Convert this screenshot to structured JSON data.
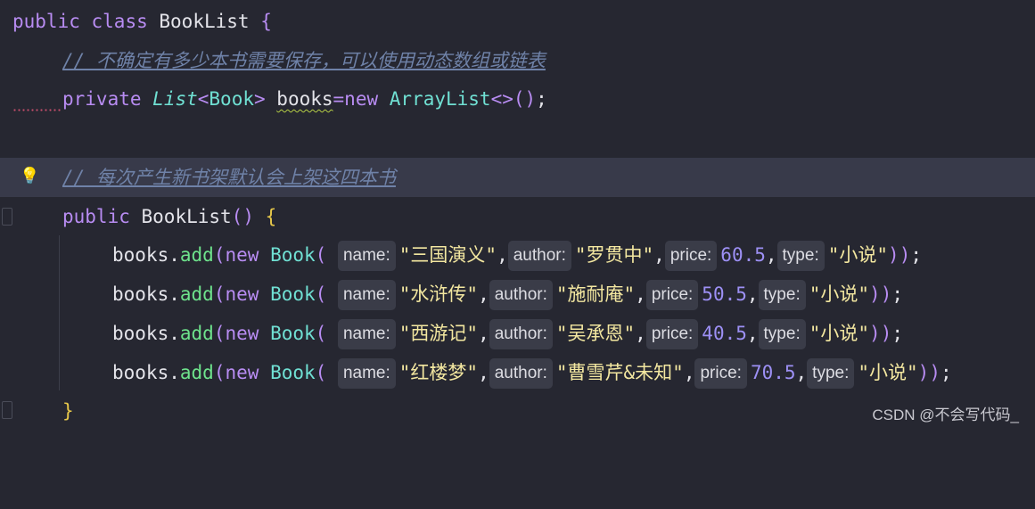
{
  "code": {
    "l1": {
      "kw_public": "public",
      "kw_class": "class",
      "class_name": "BookList",
      "open": "{"
    },
    "l2": {
      "comment": "// 不确定有多少本书需要保存，可以使用动态数组或链表"
    },
    "l3": {
      "kw_private": "private",
      "type_list": "List",
      "lt": "<",
      "type_book": "Book",
      "gt": ">",
      "field": "books",
      "eq": "=",
      "kw_new": "new",
      "type_arraylist": "ArrayList",
      "diamond": "<>",
      "parens": "()",
      "semi": ";"
    },
    "l5": {
      "comment": "// 每次产生新书架默认会上架这四本书"
    },
    "l6": {
      "kw_public": "public",
      "ctor": "BookList",
      "parens": "()",
      "open": "{"
    },
    "rows": [
      {
        "obj": "books",
        "dot": ".",
        "method": "add",
        "lp": "(",
        "kw_new": "new",
        "type": "Book",
        "lp2": "(",
        "hint_name": "name:",
        "name": "\"三国演义\"",
        "c1": ",",
        "hint_author": "author:",
        "author": "\"罗贯中\"",
        "c2": ",",
        "hint_price": "price:",
        "price": "60.5",
        "c3": ",",
        "hint_type": "type:",
        "type_val": "\"小说\"",
        "rp2": ")",
        "rp": ")",
        "semi": ";"
      },
      {
        "obj": "books",
        "dot": ".",
        "method": "add",
        "lp": "(",
        "kw_new": "new",
        "type": "Book",
        "lp2": "(",
        "hint_name": "name:",
        "name": "\"水浒传\"",
        "c1": ",",
        "hint_author": "author:",
        "author": "\"施耐庵\"",
        "c2": ",",
        "hint_price": "price:",
        "price": "50.5",
        "c3": ",",
        "hint_type": "type:",
        "type_val": "\"小说\"",
        "rp2": ")",
        "rp": ")",
        "semi": ";"
      },
      {
        "obj": "books",
        "dot": ".",
        "method": "add",
        "lp": "(",
        "kw_new": "new",
        "type": "Book",
        "lp2": "(",
        "hint_name": "name:",
        "name": "\"西游记\"",
        "c1": ",",
        "hint_author": "author:",
        "author": "\"吴承恩\"",
        "c2": ",",
        "hint_price": "price:",
        "price": "40.5",
        "c3": ",",
        "hint_type": "type:",
        "type_val": "\"小说\"",
        "rp2": ")",
        "rp": ")",
        "semi": ";"
      },
      {
        "obj": "books",
        "dot": ".",
        "method": "add",
        "lp": "(",
        "kw_new": "new",
        "type": "Book",
        "lp2": "(",
        "hint_name": "name:",
        "name": "\"红楼梦\"",
        "c1": ",",
        "hint_author": "author:",
        "author": "\"曹雪芹&未知\"",
        "c2": ",",
        "hint_price": "price:",
        "price": "70.5",
        "c3": ",",
        "hint_type": "type:",
        "type_val": "\"小说\"",
        "rp2": ")",
        "rp": ")",
        "semi": ";"
      }
    ],
    "l11": {
      "close": "}"
    }
  },
  "watermark": "CSDN @不会写代码_",
  "icons": {
    "intention": "lightbulb-icon"
  },
  "colors": {
    "background": "#262731",
    "keyword": "#b88cf2",
    "type": "#70e0d3",
    "method": "#6ee38c",
    "string": "#f3e7a0",
    "number": "#9d90f5",
    "comment": "#6f82a8"
  }
}
